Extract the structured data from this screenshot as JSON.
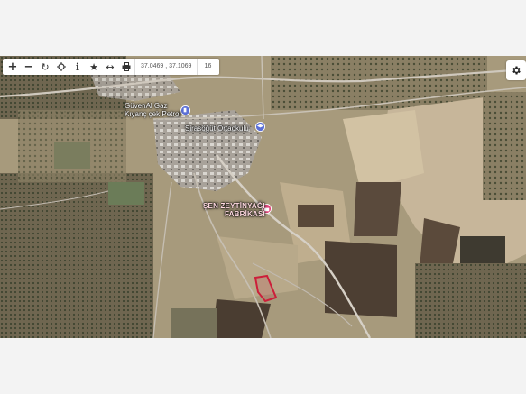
{
  "toolbar": {
    "tools": [
      {
        "name": "zoom-in-button",
        "icon": "plus-icon",
        "glyph": "+"
      },
      {
        "name": "zoom-out-button",
        "icon": "minus-icon",
        "glyph": "−"
      },
      {
        "name": "refresh-button",
        "icon": "refresh-icon",
        "glyph": "↻"
      },
      {
        "name": "locate-button",
        "icon": "crosshair-icon",
        "glyph": "⌖"
      },
      {
        "name": "info-button",
        "icon": "info-icon",
        "glyph": "i"
      },
      {
        "name": "favorite-button",
        "icon": "star-icon",
        "glyph": "★"
      },
      {
        "name": "measure-button",
        "icon": "ruler-icon",
        "glyph": "↔"
      },
      {
        "name": "print-button",
        "icon": "printer-icon",
        "glyph": "⎙"
      }
    ],
    "coordinates": "37.0469 , 37.1069",
    "zoom": "16"
  },
  "settings": {
    "icon": "gear-icon"
  },
  "map": {
    "labels": {
      "gas_station_line1": "GüvenAl Gaz",
      "gas_station_line2": "Kıyanç çek Petrol",
      "school": "Sirasöğüt Ortaokulu",
      "factory_line1": "ŞEN ZEYTİNYAĞI",
      "factory_line2": "FABRİKASI"
    },
    "poi_icons": [
      "fuel-pin-icon",
      "school-pin-icon",
      "factory-pin-icon"
    ],
    "parcel_color": "#cc1f3a",
    "accent_colors": {
      "pin_blue": "#5b6fd6",
      "pin_pink": "#e0457b"
    }
  }
}
